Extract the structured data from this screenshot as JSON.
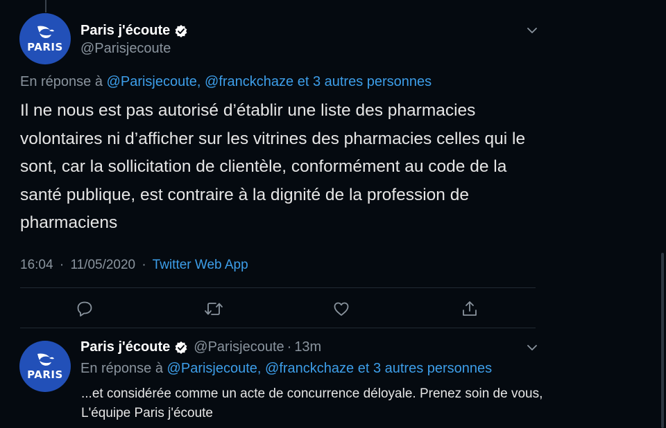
{
  "tweet": {
    "author_name": "Paris j'écoute",
    "author_handle": "@Parisjecoute",
    "avatar_text": "PARIS",
    "reply_prefix": "En réponse à",
    "reply_to": "@Parisjecoute, @franckchaze et 3 autres personnes",
    "body": "Il ne nous est pas autorisé d’établir une liste des pharmacies volontaires ni d’afficher sur les vitrines des pharmacies celles qui le sont, car la sollicitation de clientèle, conformément au code de la santé publique, est contraire à la dignité de la profession de pharmaciens",
    "time": "16:04",
    "date": "11/05/2020",
    "source": "Twitter Web App",
    "separator": "·"
  },
  "actions": {
    "reply_icon": "comment-icon",
    "retweet_icon": "retweet-icon",
    "like_icon": "heart-icon",
    "share_icon": "share-icon"
  },
  "reply": {
    "author_name": "Paris j'écoute",
    "author_handle": "@Parisjecoute",
    "separator": "·",
    "age": "13m",
    "avatar_text": "PARIS",
    "reply_prefix": "En réponse à",
    "reply_to": "@Parisjecoute, @franckchaze et 3 autres personnes",
    "body": "...et considérée comme un acte de concurrence déloyale. Prenez soin de vous, L'équipe Paris j'écoute"
  },
  "colors": {
    "background": "#050a10",
    "link": "#3d9ee9",
    "avatar": "#2250b8",
    "muted": "#8a949e"
  }
}
